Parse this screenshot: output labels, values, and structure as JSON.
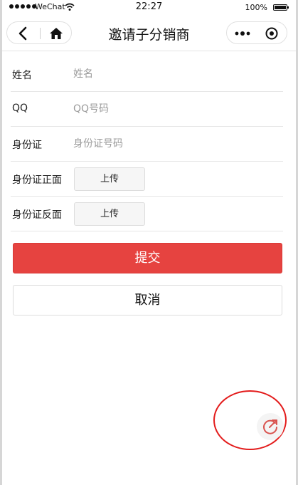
{
  "status_bar": {
    "carrier": "WeChat",
    "time": "22:27",
    "battery": "100%"
  },
  "nav": {
    "title": "邀请子分销商",
    "icons": {
      "back": "chevron-left-icon",
      "home": "home-icon",
      "more": "more-dots-icon",
      "close": "target-circle-icon"
    }
  },
  "form": {
    "fields": [
      {
        "label": "姓名",
        "placeholder": "姓名"
      },
      {
        "label": "QQ",
        "placeholder": "QQ号码"
      },
      {
        "label": "身份证",
        "placeholder": "身份证号码"
      }
    ],
    "uploads": [
      {
        "label": "身份证正面",
        "button": "上传"
      },
      {
        "label": "身份证反面",
        "button": "上传"
      }
    ],
    "submit_label": "提交",
    "cancel_label": "取消"
  },
  "colors": {
    "primary": "#e64340",
    "annotation": "#e31d1d",
    "share_icon": "#d9534f"
  },
  "floating": {
    "share_icon": "share-icon"
  }
}
